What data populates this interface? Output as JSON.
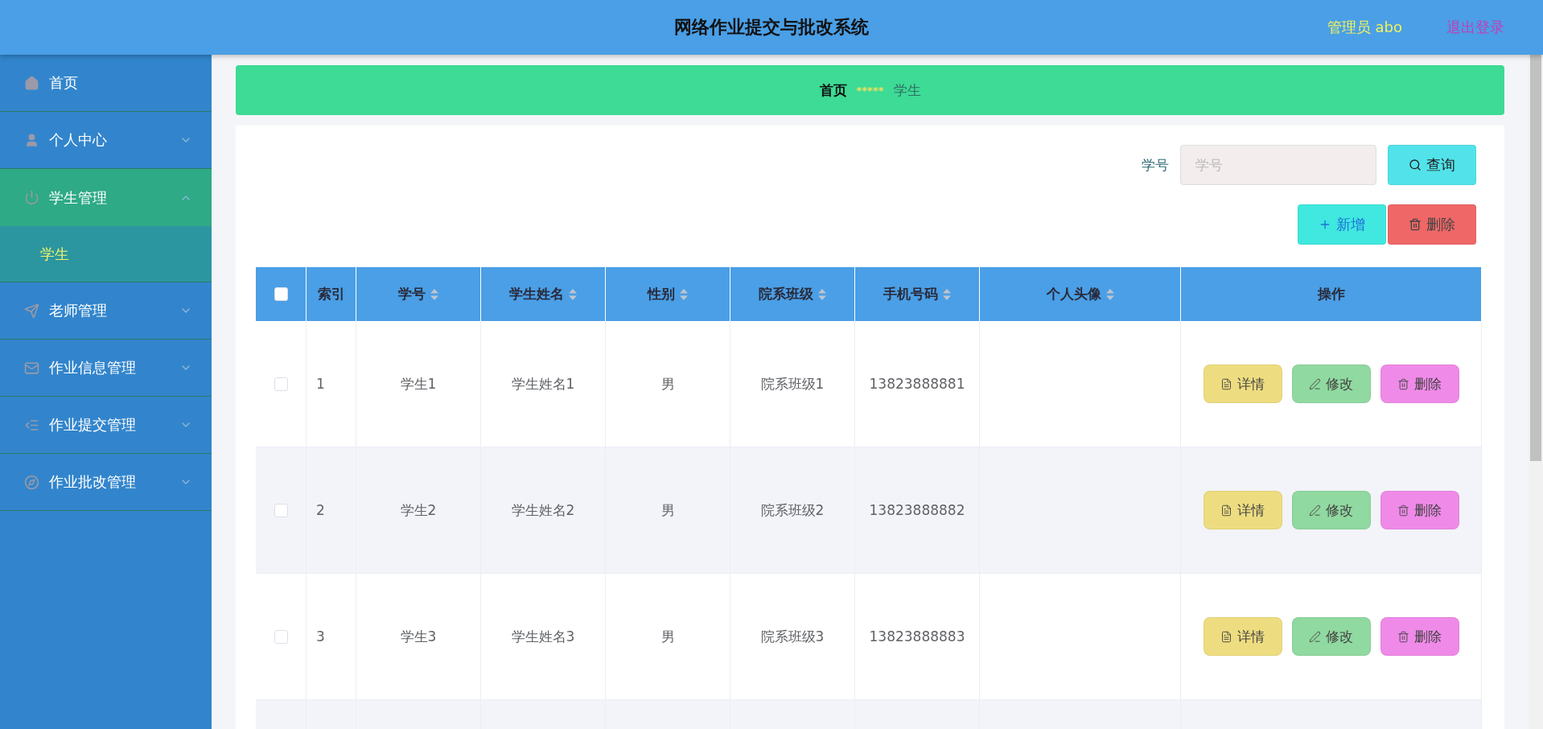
{
  "header": {
    "title": "网络作业提交与批改系统",
    "user": "管理员 abo",
    "logout": "退出登录"
  },
  "sidebar": {
    "items": [
      {
        "label": "首页",
        "selected": false
      },
      {
        "label": "个人中心",
        "selected": false,
        "expanded": false
      },
      {
        "label": "学生管理",
        "selected": true,
        "expanded": true,
        "children": [
          {
            "label": "学生",
            "selected": true
          }
        ]
      },
      {
        "label": "老师管理",
        "selected": false,
        "expanded": false
      },
      {
        "label": "作业信息管理",
        "selected": false,
        "expanded": false
      },
      {
        "label": "作业提交管理",
        "selected": false,
        "expanded": false
      },
      {
        "label": "作业批改管理",
        "selected": false,
        "expanded": false
      }
    ]
  },
  "breadcrumb": {
    "items": [
      {
        "label": "首页",
        "current": false
      },
      {
        "label": "学生",
        "current": true
      }
    ],
    "separator": "*****"
  },
  "search": {
    "label": "学号",
    "placeholder": "学号",
    "button": "查询"
  },
  "actions": [
    {
      "kind": "add",
      "label": "新增"
    },
    {
      "kind": "delete",
      "label": "删除"
    }
  ],
  "table": {
    "select_all_checked": false,
    "columns": [
      {
        "label": "索引",
        "sortable": false
      },
      {
        "label": "学号",
        "sortable": true
      },
      {
        "label": "学生姓名",
        "sortable": true
      },
      {
        "label": "性别",
        "sortable": true
      },
      {
        "label": "院系班级",
        "sortable": true
      },
      {
        "label": "手机号码",
        "sortable": true
      },
      {
        "label": "个人头像",
        "sortable": true
      },
      {
        "label": "操作",
        "sortable": false
      }
    ],
    "rows": [
      {
        "checked": false,
        "cells": [
          "1",
          "学生1",
          "学生姓名1",
          "男",
          "院系班级1",
          "13823888881"
        ],
        "actions": [
          {
            "kind": "detail",
            "label": "详情"
          },
          {
            "kind": "edit",
            "label": "修改"
          },
          {
            "kind": "delete",
            "label": "删除"
          }
        ]
      },
      {
        "checked": false,
        "cells": [
          "2",
          "学生2",
          "学生姓名2",
          "男",
          "院系班级2",
          "13823888882"
        ],
        "actions": [
          {
            "kind": "detail",
            "label": "详情"
          },
          {
            "kind": "edit",
            "label": "修改"
          },
          {
            "kind": "delete",
            "label": "删除"
          }
        ]
      },
      {
        "checked": false,
        "cells": [
          "3",
          "学生3",
          "学生姓名3",
          "男",
          "院系班级3",
          "13823888883"
        ],
        "actions": [
          {
            "kind": "detail",
            "label": "详情"
          },
          {
            "kind": "edit",
            "label": "修改"
          },
          {
            "kind": "delete",
            "label": "删除"
          }
        ]
      }
    ]
  }
}
